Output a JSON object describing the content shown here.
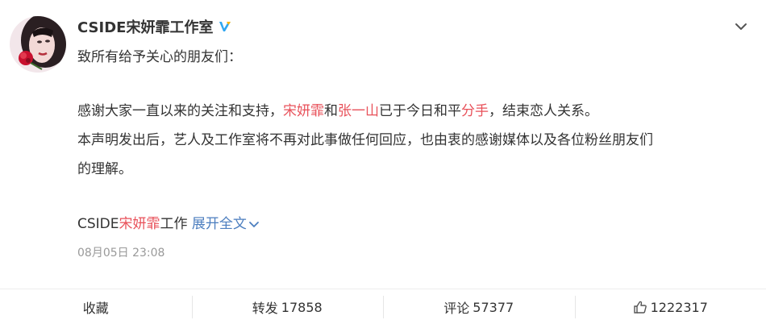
{
  "post": {
    "username": "CSIDE宋妍霏工作室",
    "greeting": "致所有给予关心的朋友们：",
    "line1": {
      "part1": "感谢大家一直以来的关注和支持，",
      "name1": "宋妍霏",
      "and": "和",
      "name2": "张一山",
      "part2": "已于今日和平",
      "breakup": "分手",
      "part3": "，结束恋人关系。"
    },
    "line2": "本声明发出后，艺人及工作室将不再对此事做任何回应，也由衷的感谢媒体以及各位粉丝朋友们",
    "line3": "的理解。",
    "signature": {
      "prefix": "CSIDE",
      "name": "宋妍霏",
      "suffix": "工作"
    },
    "expand_label": "展开全文",
    "timestamp": "08月05日 23:08"
  },
  "actions": {
    "favorite": {
      "label": "收藏"
    },
    "repost": {
      "label": "转发",
      "count": "17858"
    },
    "comment": {
      "label": "评论",
      "count": "57377"
    },
    "like": {
      "count": "1222317"
    }
  },
  "colors": {
    "text": "#333333",
    "highlight_red": "#e8515a",
    "link_blue": "#4c7ebf",
    "muted": "#999999",
    "verified_blue": "#2fa6f0"
  },
  "icons": {
    "verified": "verified-badge-icon",
    "menu": "chevron-down-icon",
    "expand": "chevron-down-icon",
    "like": "thumbs-up-icon"
  }
}
